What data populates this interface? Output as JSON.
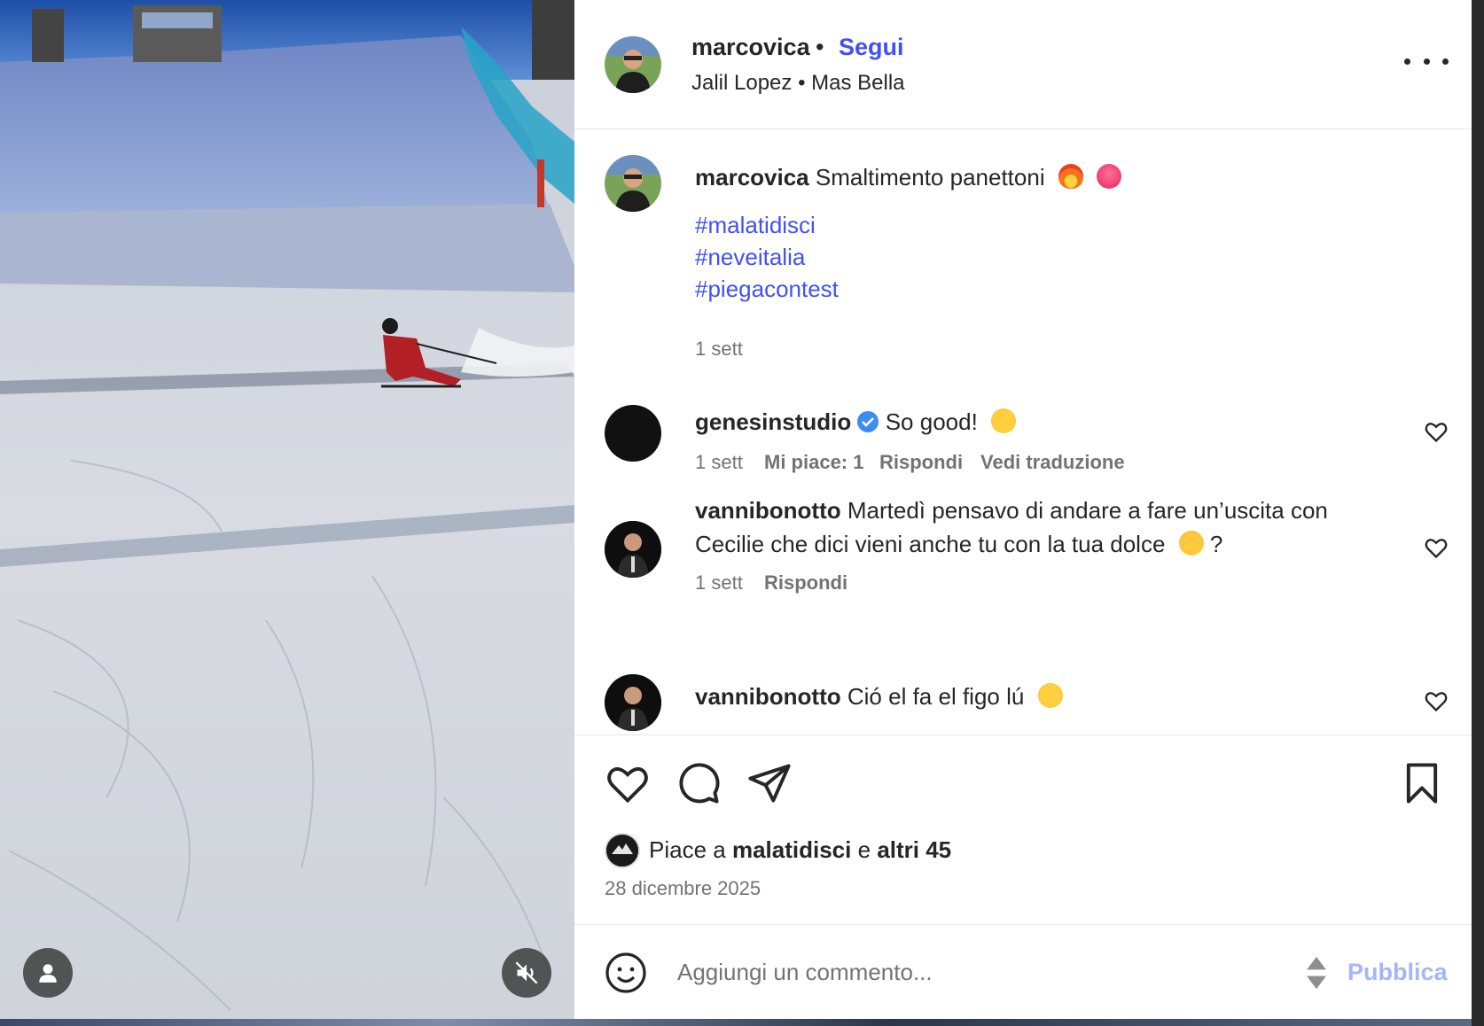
{
  "header": {
    "username": "marcovica",
    "separator": "•",
    "follow_label": "Segui",
    "audio": "Jalil Lopez • Mas Bella"
  },
  "caption": {
    "username": "marcovica",
    "text": "Smaltimento panettoni",
    "emojis": [
      "fire",
      "heart-face"
    ],
    "hashtags": [
      "#malatidisci",
      "#neveitalia",
      "#piegacontest"
    ],
    "time": "1 sett"
  },
  "comments": [
    {
      "username": "genesinstudio",
      "verified": true,
      "text": "So good!",
      "emoji": "star-struck",
      "time": "1 sett",
      "likes": "Mi piace: 1",
      "reply": "Rispondi",
      "translate": "Vedi traduzione"
    },
    {
      "username": "vannibonotto",
      "text_line1": "Martedì pensavo di andare a fare un’uscita con",
      "text_line2": "Cecilie che dici vieni anche tu con la tua dolce",
      "text_end": "?",
      "emoji": "blonde-person",
      "time": "1 sett",
      "reply": "Rispondi"
    },
    {
      "username": "vannibonotto",
      "text": "Ció el fa el figo lú",
      "emoji": "grinning-sweat"
    }
  ],
  "likes": {
    "prefix": "Piace a",
    "user": "malatidisci",
    "middle": "e",
    "others": "altri 45"
  },
  "date": "28 dicembre 2025",
  "composer": {
    "placeholder": "Aggiungi un commento...",
    "publish_label": "Pubblica"
  },
  "colors": {
    "link": "#4150f7",
    "publish_disabled": "#a4b6fb",
    "secondary_text": "#737373"
  }
}
